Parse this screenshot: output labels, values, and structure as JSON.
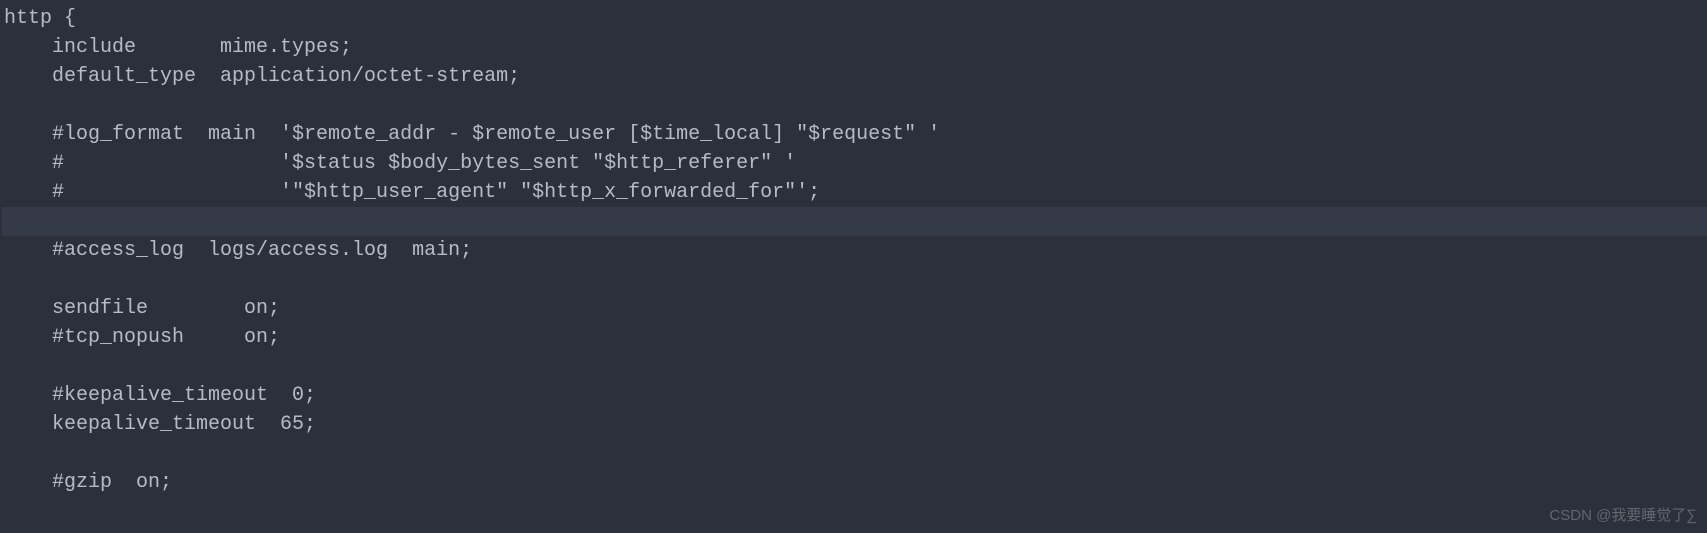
{
  "code": {
    "lines": [
      "http {",
      "    include       mime.types;",
      "    default_type  application/octet-stream;",
      "",
      "    #log_format  main  '$remote_addr - $remote_user [$time_local] \"$request\" '",
      "    #                  '$status $body_bytes_sent \"$http_referer\" '",
      "    #                  '\"$http_user_agent\" \"$http_x_forwarded_for\"';",
      "",
      "    #access_log  logs/access.log  main;",
      "",
      "    sendfile        on;",
      "    #tcp_nopush     on;",
      "",
      "    #keepalive_timeout  0;",
      "    keepalive_timeout  65;",
      "",
      "    #gzip  on;"
    ],
    "highlighted_line_index": 7
  },
  "watermark": "CSDN @我要睡觉了∑"
}
